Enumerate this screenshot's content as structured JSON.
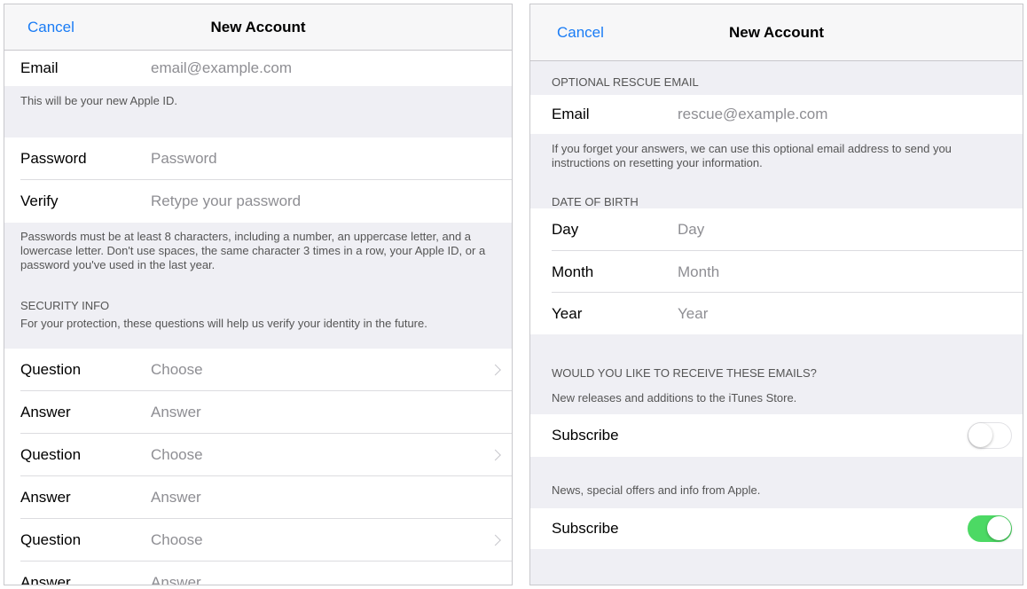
{
  "left": {
    "nav": {
      "cancel": "Cancel",
      "title": "New Account"
    },
    "email": {
      "label": "Email",
      "placeholder": "email@example.com"
    },
    "email_note": "This will be your new Apple ID.",
    "password": {
      "label": "Password",
      "placeholder": "Password"
    },
    "verify": {
      "label": "Verify",
      "placeholder": "Retype your password"
    },
    "password_note": "Passwords must be at least 8 characters, including a number, an uppercase letter, and a lowercase letter. Don't use spaces, the same character 3 times in a row, your Apple ID, or a password you've used in the last year.",
    "security_header": "SECURITY INFO",
    "security_note": "For your protection, these questions will help us verify your identity in the future.",
    "questions": [
      {
        "question_label": "Question",
        "question_value": "Choose",
        "answer_label": "Answer",
        "answer_placeholder": "Answer"
      },
      {
        "question_label": "Question",
        "question_value": "Choose",
        "answer_label": "Answer",
        "answer_placeholder": "Answer"
      },
      {
        "question_label": "Question",
        "question_value": "Choose",
        "answer_label": "Answer",
        "answer_placeholder": "Answer"
      }
    ]
  },
  "right": {
    "nav": {
      "cancel": "Cancel",
      "title": "New Account"
    },
    "rescue_header": "OPTIONAL RESCUE EMAIL",
    "rescue_email": {
      "label": "Email",
      "placeholder": "rescue@example.com"
    },
    "rescue_note": "If you forget your answers, we can use this optional email address to send you instructions on resetting your information.",
    "dob_header": "DATE OF BIRTH",
    "day": {
      "label": "Day",
      "placeholder": "Day"
    },
    "month": {
      "label": "Month",
      "placeholder": "Month"
    },
    "year": {
      "label": "Year",
      "placeholder": "Year"
    },
    "emails_header": "WOULD YOU LIKE TO RECEIVE THESE EMAILS?",
    "itunes_note": "New releases and additions to the iTunes Store.",
    "subscribe_itunes": {
      "label": "Subscribe",
      "state": "off"
    },
    "apple_note": "News, special offers and info from Apple.",
    "subscribe_apple": {
      "label": "Subscribe",
      "state": "on"
    }
  },
  "colors": {
    "accent": "#1a7cf5",
    "toggle_on": "#4cd964",
    "group_bg": "#efeff4"
  }
}
